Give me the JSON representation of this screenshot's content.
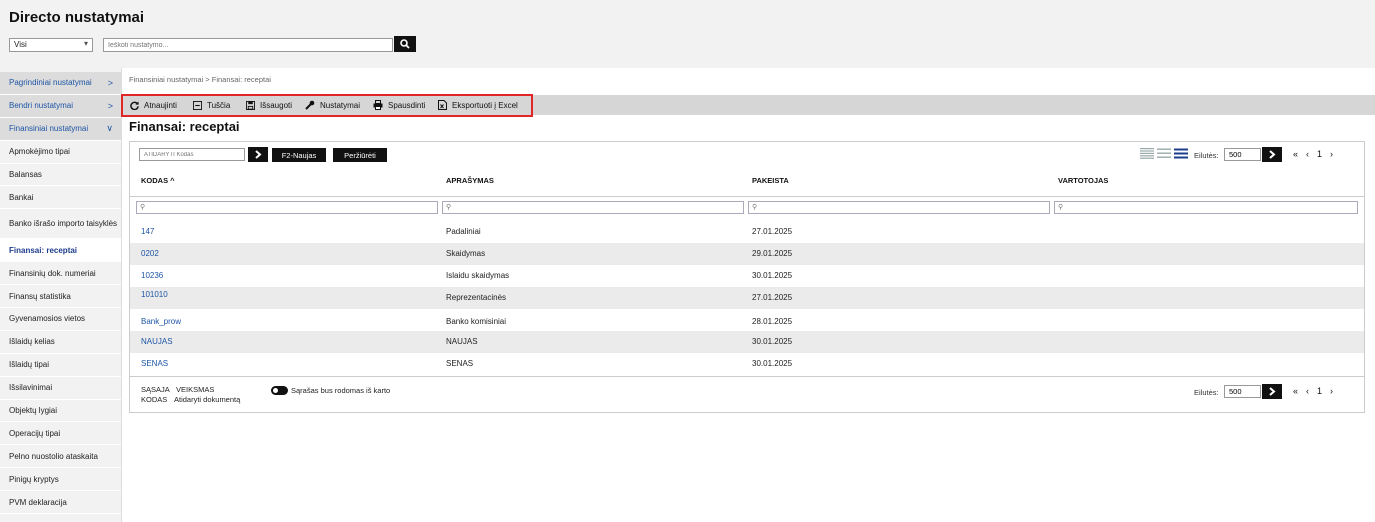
{
  "app": {
    "title": "Directo nustatymai"
  },
  "search": {
    "filter_value": "Visi",
    "placeholder": "Ieškoti nustatymo..."
  },
  "sidebar": {
    "groups": [
      {
        "label": "Pagrindiniai nustatymai",
        "chevron": ">"
      },
      {
        "label": "Bendri nustatymai",
        "chevron": ">"
      },
      {
        "label": "Finansiniai nustatymai",
        "chevron": "∨"
      }
    ],
    "items": [
      "Apmokėjimo tipai",
      "Balansas",
      "Bankai",
      "Banko išrašo importo taisyklės",
      "Finansai: receptai",
      "Finansinių dok. numeriai",
      "Finansų statistika",
      "Gyvenamosios vietos",
      "Išlaidų kelias",
      "Išlaidų tipai",
      "Išsilavinimai",
      "Objektų lygiai",
      "Operacijų tipai",
      "Pelno nuostolio ataskaita",
      "Pinigų kryptys",
      "PVM deklaracija"
    ],
    "active_item": "Finansai: receptai"
  },
  "breadcrumb": {
    "text": "Finansiniai nustatymai > Finansai: receptai"
  },
  "toolbar": {
    "refresh": "Atnaujinti",
    "empty": "Tuščia",
    "save": "Išsaugoti",
    "settings": "Nustatymai",
    "print": "Spausdinti",
    "export": "Eksportuoti į Excel"
  },
  "page": {
    "title": "Finansai: receptai"
  },
  "controls": {
    "open_placeholder": "ATIDARYTI Kodas",
    "new_button": "F2-Naujas",
    "browse_button": "Peržiūrėti",
    "rows_label": "Eilutės:",
    "rows_value": "500",
    "page_number": "1"
  },
  "table": {
    "columns": [
      "KODAS ^",
      "APRAŠYMAS",
      "PAKEISTA",
      "VARTOTOJAS"
    ],
    "rows": [
      {
        "code": "147",
        "description": "Padaliniai",
        "changed": "27.01.2025",
        "user": ""
      },
      {
        "code": "0202",
        "description": "Skaidymas",
        "changed": "29.01.2025",
        "user": ""
      },
      {
        "code": "10236",
        "description": "Islaidu skaidymas",
        "changed": "30.01.2025",
        "user": ""
      },
      {
        "code": "101010",
        "description": "Reprezentacinės",
        "changed": "27.01.2025",
        "user": ""
      },
      {
        "code": "Bank_prow",
        "description": "Banko komisiniai",
        "changed": "28.01.2025",
        "user": ""
      },
      {
        "code": "NAUJAS",
        "description": "NAUJAS",
        "changed": "30.01.2025",
        "user": ""
      },
      {
        "code": "SENAS",
        "description": "SENAS",
        "changed": "30.01.2025",
        "user": ""
      }
    ]
  },
  "footer": {
    "col1_header": "SĄSAJA",
    "col2_header": "VEIKSMAS",
    "col1_value": "KODAS",
    "col2_value": "Atidaryti dokumentą",
    "toggle_label": "Sąrašas bus rodomas iš karto"
  }
}
